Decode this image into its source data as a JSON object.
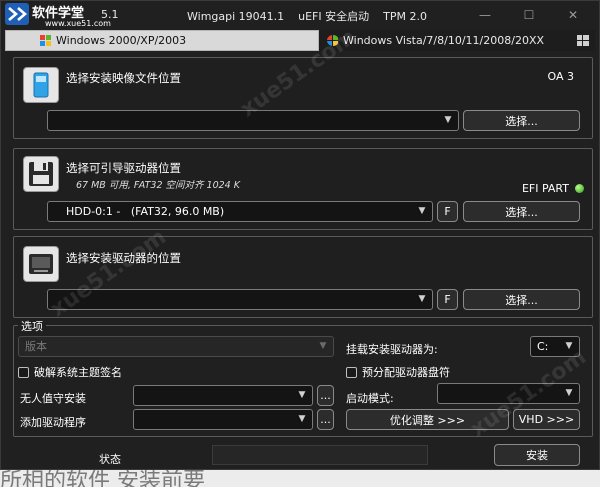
{
  "titlebar": {
    "brand": "软件学堂",
    "brand_sub": "www.xue51.com",
    "version": "5.1",
    "title": "Wimgapi 19041.1    uEFI 安全启动    TPM 2.0",
    "minimize": "—",
    "maximize": "☐",
    "close": "✕"
  },
  "tabs": [
    {
      "label": "Windows 2000/XP/2003"
    },
    {
      "label": "Windows Vista/7/8/10/11/2008/20XX"
    }
  ],
  "panel_image": {
    "title": "选择安装映像文件位置",
    "badge": "OA 3",
    "combo_value": "",
    "button": "选择..."
  },
  "panel_boot": {
    "title": "选择可引导驱动器位置",
    "subtitle": "67 MB 可用, FAT32 空间对齐 1024 K",
    "badge": "EFI PART",
    "combo_value": "HDD-0:1 -   (FAT32, 96.0 MB)",
    "f_button": "F",
    "button": "选择..."
  },
  "panel_install": {
    "title": "选择安装驱动器的位置",
    "combo_value": "",
    "f_button": "F",
    "button": "选择..."
  },
  "options": {
    "legend": "选项",
    "edition_placeholder": "版本",
    "mount_label": "挂载安装驱动器为:",
    "mount_value": "C:",
    "crack_theme_label": "破解系统主题签名",
    "pre_assign_label": "预分配驱动器盘符",
    "unattended_label": "无人值守安装",
    "unattended_value": "",
    "browse": "...",
    "boot_mode_label": "启动模式:",
    "boot_mode_value": "",
    "add_driver_label": "添加驱动程序",
    "add_driver_value": "",
    "tweaks_button": "优化调整 >>>",
    "vhd_button": "VHD >>>"
  },
  "status": {
    "label": "状态",
    "value": "",
    "install_button": "安装"
  },
  "footer_text": "所相的软件 安装前要"
}
